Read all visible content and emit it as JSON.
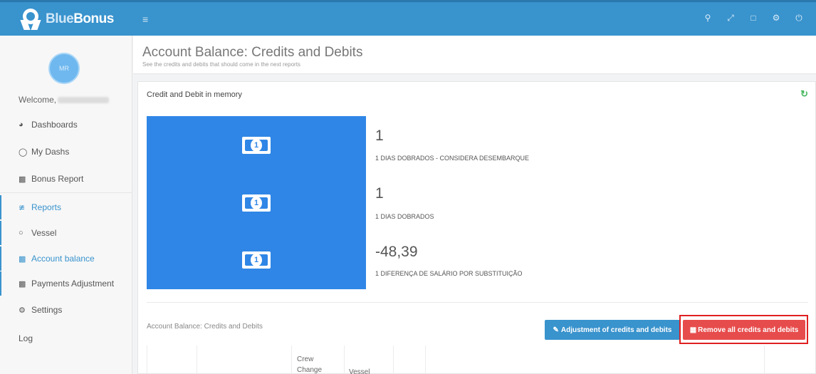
{
  "brand": {
    "name_part1": "Blue",
    "name_part2": "Bonus"
  },
  "topbar": {
    "menu_icon": "hamburger-icon",
    "icons": [
      "search-icon",
      "expand-icon",
      "square-icon",
      "gears-icon",
      "power-icon"
    ]
  },
  "sidebar": {
    "avatar_text": "MR",
    "welcome": "Welcome,",
    "items": [
      {
        "label": "Dashboards",
        "icon": "dashboard-icon"
      },
      {
        "label": "My Dashs",
        "icon": "user-icon"
      },
      {
        "label": "Bonus Report",
        "icon": "money-icon"
      },
      {
        "label": "Reports",
        "icon": "line-chart-icon"
      },
      {
        "label": "Vessel",
        "icon": "circle-icon"
      },
      {
        "label": "Account balance",
        "icon": "money-icon"
      },
      {
        "label": "Payments Adjustment",
        "icon": "money-icon"
      },
      {
        "label": "Settings",
        "icon": "gears-icon"
      },
      {
        "label": "Log",
        "icon": ""
      }
    ]
  },
  "page": {
    "title": "Account Balance: Credits and Debits",
    "subtitle": "See the credits and debits that should come in the next reports"
  },
  "panel": {
    "heading": "Credit and Debit in memory",
    "refresh_icon": "refresh-icon",
    "stats": [
      {
        "value": "1",
        "label": "1 DIAS DOBRADOS - CONSIDERA DESEMBARQUE"
      },
      {
        "value": "1",
        "label": "1 DIAS DOBRADOS"
      },
      {
        "value": "-48,39",
        "label": "1 DIFERENÇA DE SALÁRIO POR SUBSTITUIÇÃO"
      }
    ],
    "section_label": "Account Balance: Credits and Debits",
    "buttons": {
      "adjust": "Adjustment of credits and debits",
      "remove": "Remove all credits and debits"
    },
    "table_headers": [
      "Crew Change",
      "Vessel"
    ]
  },
  "colors": {
    "topbar": "#3993cd",
    "stat_box": "#2f86e6",
    "danger": "#e74c4c",
    "highlight_border": "#e02020"
  }
}
